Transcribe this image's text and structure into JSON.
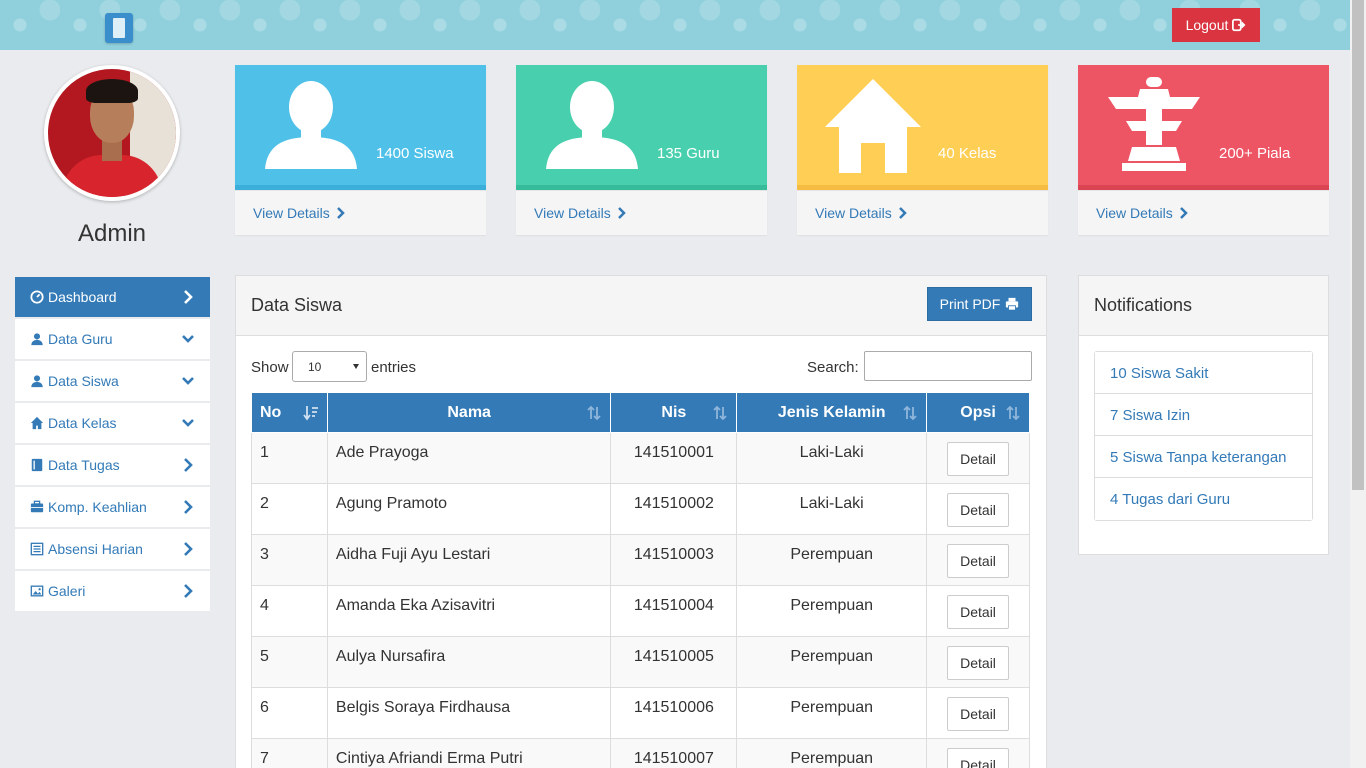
{
  "header": {
    "logout_label": "Logout"
  },
  "profile": {
    "name": "Admin"
  },
  "sidebar": {
    "items": [
      {
        "label": "Dashboard",
        "icon": "dashboard-icon"
      },
      {
        "label": "Data Guru",
        "icon": "user-icon"
      },
      {
        "label": "Data Siswa",
        "icon": "user-icon"
      },
      {
        "label": "Data Kelas",
        "icon": "home-icon"
      },
      {
        "label": "Data Tugas",
        "icon": "book-icon"
      },
      {
        "label": "Komp. Keahlian",
        "icon": "briefcase-icon"
      },
      {
        "label": "Absensi Harian",
        "icon": "list-icon"
      },
      {
        "label": "Galeri",
        "icon": "picture-icon"
      }
    ]
  },
  "cards": [
    {
      "count": "1400 Siswa",
      "link": "View Details",
      "color": "#4fc1e9",
      "strip": "#3bafda",
      "icon": "user-silhouette-icon"
    },
    {
      "count": "135 Guru",
      "link": "View Details",
      "color": "#48cfad",
      "strip": "#37bc9b",
      "icon": "user-silhouette-icon"
    },
    {
      "count": "40 Kelas",
      "link": "View Details",
      "color": "#ffce54",
      "strip": "#f6bb42",
      "icon": "house-icon"
    },
    {
      "count": "200+ Piala",
      "link": "View Details",
      "color": "#ed5565",
      "strip": "#da4453",
      "icon": "trophy-icon"
    }
  ],
  "data_siswa": {
    "title": "Data Siswa",
    "print_label": "Print PDF",
    "show_label": "Show",
    "page_size": "10",
    "entries_label": "entries",
    "search_label": "Search:",
    "search_value": "",
    "columns": [
      "No",
      "Nama",
      "Nis",
      "Jenis Kelamin",
      "Opsi"
    ],
    "rows": [
      {
        "no": "1",
        "nama": "Ade Prayoga",
        "nis": "141510001",
        "jk": "Laki-Laki",
        "opsi": "Detail"
      },
      {
        "no": "2",
        "nama": "Agung Pramoto",
        "nis": "141510002",
        "jk": "Laki-Laki",
        "opsi": "Detail"
      },
      {
        "no": "3",
        "nama": "Aidha Fuji Ayu Lestari",
        "nis": "141510003",
        "jk": "Perempuan",
        "opsi": "Detail"
      },
      {
        "no": "4",
        "nama": "Amanda Eka Azisavitri",
        "nis": "141510004",
        "jk": "Perempuan",
        "opsi": "Detail"
      },
      {
        "no": "5",
        "nama": "Aulya Nursafira",
        "nis": "141510005",
        "jk": "Perempuan",
        "opsi": "Detail"
      },
      {
        "no": "6",
        "nama": "Belgis Soraya Firdhausa",
        "nis": "141510006",
        "jk": "Perempuan",
        "opsi": "Detail"
      },
      {
        "no": "7",
        "nama": "Cintiya Afriandi Erma Putri",
        "nis": "141510007",
        "jk": "Perempuan",
        "opsi": "Detail"
      }
    ]
  },
  "notifications": {
    "title": "Notifications",
    "items": [
      "10 Siswa Sakit",
      "7 Siswa Izin",
      "5 Siswa Tanpa keterangan",
      "4 Tugas dari Guru"
    ]
  }
}
